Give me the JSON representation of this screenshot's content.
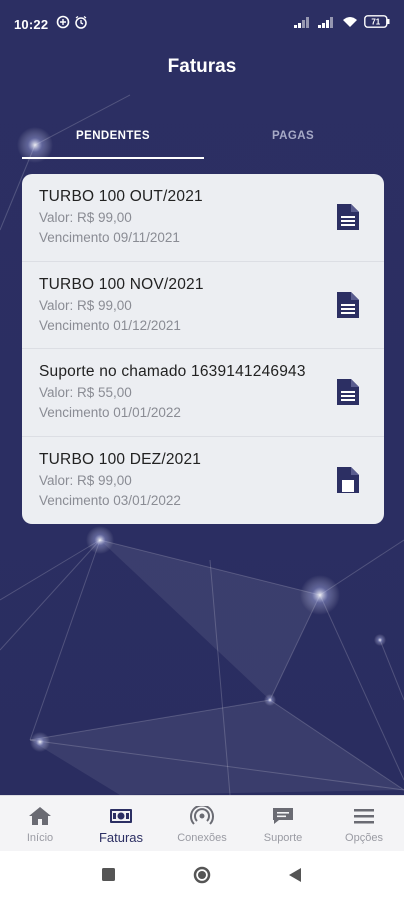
{
  "status_bar": {
    "time": "10:22",
    "battery": "71"
  },
  "header": {
    "title": "Faturas"
  },
  "tabs": [
    {
      "label": "PENDENTES",
      "active": true
    },
    {
      "label": "PAGAS",
      "active": false
    }
  ],
  "invoices": [
    {
      "title": "TURBO 100 OUT/2021",
      "value": "Valor: R$ 99,00",
      "due": "Vencimento 09/11/2021",
      "icon": "document-icon"
    },
    {
      "title": "TURBO 100 NOV/2021",
      "value": "Valor: R$ 99,00",
      "due": "Vencimento 01/12/2021",
      "icon": "document-icon"
    },
    {
      "title": "Suporte no chamado 1639141246943",
      "value": "Valor: R$ 55,00",
      "due": "Vencimento 01/01/2022",
      "icon": "document-icon"
    },
    {
      "title": "TURBO 100 DEZ/2021",
      "value": "Valor: R$ 99,00",
      "due": "Vencimento 03/01/2022",
      "icon": "document-icon"
    }
  ],
  "bottom_nav": [
    {
      "label": "Início",
      "icon": "home-icon",
      "active": false
    },
    {
      "label": "Faturas",
      "icon": "invoice-icon",
      "active": true
    },
    {
      "label": "Conexões",
      "icon": "connection-icon",
      "active": false
    },
    {
      "label": "Suporte",
      "icon": "chat-icon",
      "active": false
    },
    {
      "label": "Opções",
      "icon": "menu-icon",
      "active": false
    }
  ],
  "colors": {
    "primary": "#2c2f63",
    "card": "#eceef2",
    "inactive": "#9a9ba3"
  }
}
